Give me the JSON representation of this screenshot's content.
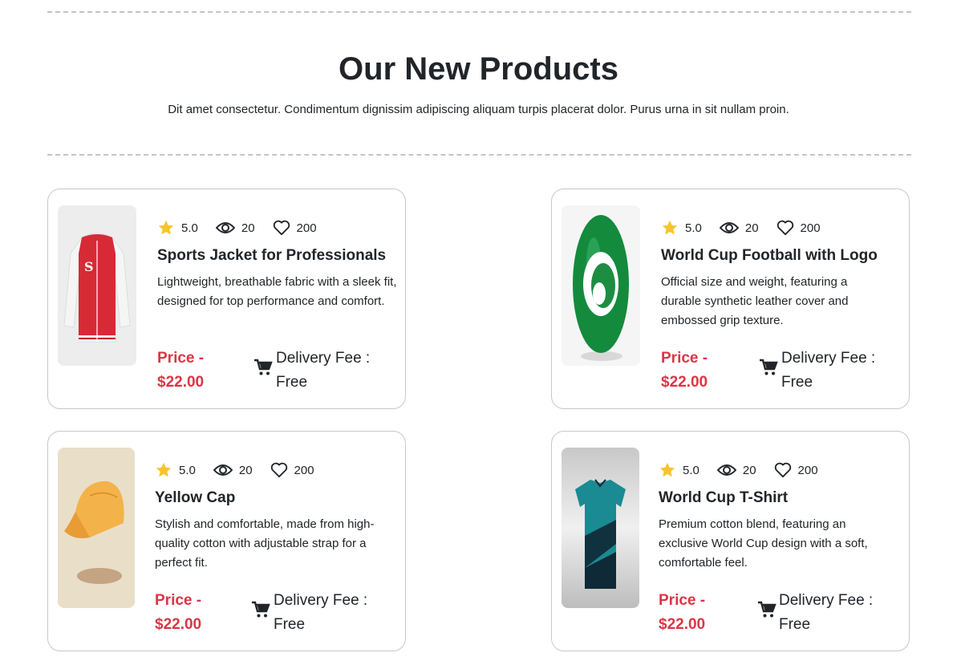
{
  "section": {
    "title": "Our New Products",
    "subtitle": "Dit amet consectetur. Condimentum dignissim adipiscing aliquam turpis placerat dolor. Purus urna in sit nullam proin."
  },
  "colors": {
    "price": "#dc3545",
    "star": "#f7c52b",
    "border": "#c8c8c8"
  },
  "products": [
    {
      "rating": "5.0",
      "views": "20",
      "likes": "200",
      "name": "Sports Jacket for Professionals",
      "description": "Lightweight, breathable fabric with a sleek fit, designed for top performance and comfort.",
      "price_label": "Price -",
      "price": "$22.00",
      "delivery_label": "Delivery Fee :",
      "delivery_value": "Free",
      "image_icon": "red-varsity-jacket"
    },
    {
      "rating": "5.0",
      "views": "20",
      "likes": "200",
      "name": "World Cup Football with Logo",
      "description": "Official size and weight, featuring a durable synthetic leather cover and embossed grip texture.",
      "price_label": "Price -",
      "price": "$22.00",
      "delivery_label": "Delivery Fee :",
      "delivery_value": "Free",
      "image_icon": "green-football"
    },
    {
      "rating": "5.0",
      "views": "20",
      "likes": "200",
      "name": "Yellow Cap",
      "description": "Stylish and comfortable, made from high-quality cotton with adjustable strap for a perfect fit.",
      "price_label": "Price -",
      "price": "$22.00",
      "delivery_label": "Delivery Fee :",
      "delivery_value": "Free",
      "image_icon": "yellow-cap"
    },
    {
      "rating": "5.0",
      "views": "20",
      "likes": "200",
      "name": "World Cup T-Shirt",
      "description": "Premium cotton blend, featuring an exclusive World Cup design with a soft, comfortable feel.",
      "price_label": "Price -",
      "price": "$22.00",
      "delivery_label": "Delivery Fee :",
      "delivery_value": "Free",
      "image_icon": "teal-jersey"
    }
  ]
}
